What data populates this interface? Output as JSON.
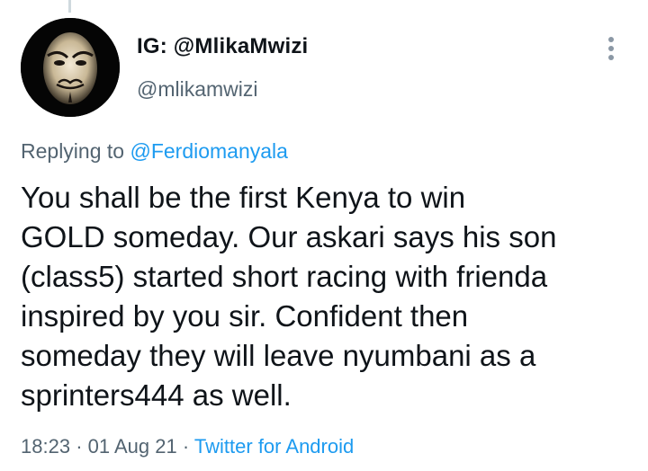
{
  "tweet": {
    "author": {
      "display_name": "IG: @MlikaMwizi",
      "handle": "@mlikamwizi",
      "avatar_icon": "guy-fawkes-mask-avatar"
    },
    "replying_to": {
      "prefix": "Replying to",
      "mention": "@Ferdiomanyala"
    },
    "text_lines": [
      "You shall be the first Kenya to win",
      "GOLD someday. Our askari says his son",
      "(class5) started short racing with frienda",
      "inspired by you sir. Confident then",
      "someday they will leave nyumbani as a",
      "sprinters444 as well."
    ],
    "time": "18:23",
    "separator": "·",
    "date": "01 Aug 21",
    "source": "Twitter for Android"
  },
  "colors": {
    "text": "#0f1419",
    "secondary": "#536471",
    "link": "#1d9bf0"
  }
}
